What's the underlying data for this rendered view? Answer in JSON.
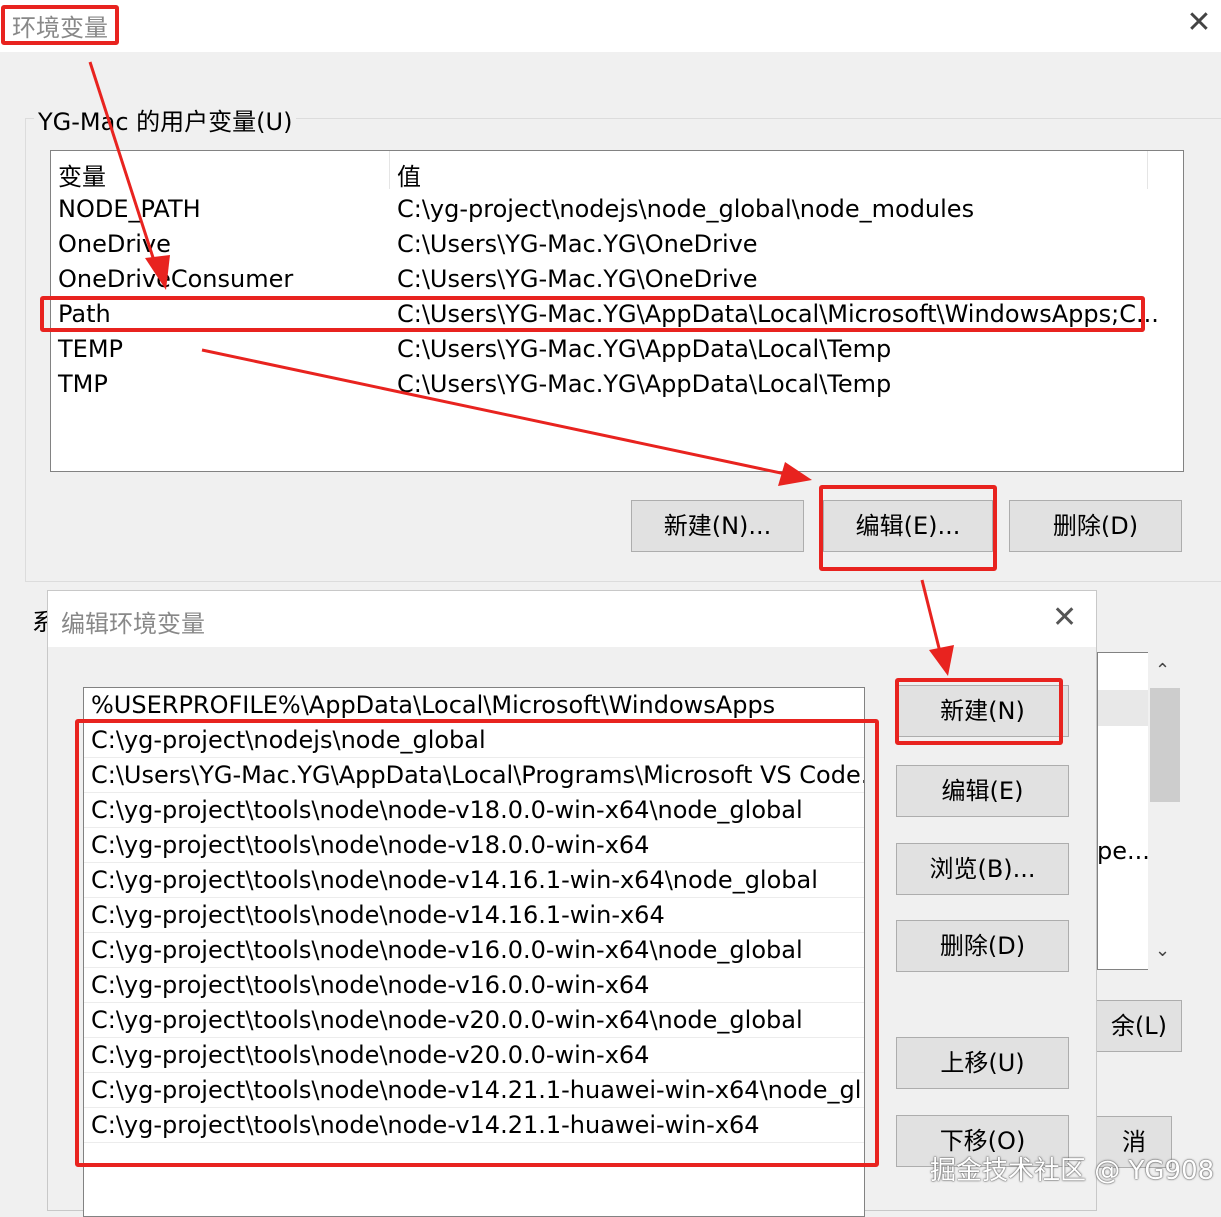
{
  "outer_dialog": {
    "title": "环境变量",
    "user_group_label": "YG-Mac 的用户变量(U)",
    "columns": {
      "name": "变量",
      "value": "值"
    },
    "user_vars": [
      {
        "name": "NODE_PATH",
        "value": "C:\\yg-project\\nodejs\\node_global\\node_modules"
      },
      {
        "name": "OneDrive",
        "value": "C:\\Users\\YG-Mac.YG\\OneDrive"
      },
      {
        "name": "OneDriveConsumer",
        "value": "C:\\Users\\YG-Mac.YG\\OneDrive"
      },
      {
        "name": "Path",
        "value": "C:\\Users\\YG-Mac.YG\\AppData\\Local\\Microsoft\\WindowsApps;C..."
      },
      {
        "name": "TEMP",
        "value": "C:\\Users\\YG-Mac.YG\\AppData\\Local\\Temp"
      },
      {
        "name": "TMP",
        "value": "C:\\Users\\YG-Mac.YG\\AppData\\Local\\Temp"
      }
    ],
    "buttons": {
      "new": "新建(N)...",
      "edit": "编辑(E)...",
      "delete": "删除(D)"
    },
    "sys_group_label_peek": "系",
    "sys_text_peek": "pe...",
    "sys_delete_peek": "余(L)",
    "cancel_peek": "消"
  },
  "inner_dialog": {
    "title": "编辑环境变量",
    "paths": [
      "%USERPROFILE%\\AppData\\Local\\Microsoft\\WindowsApps",
      "C:\\yg-project\\nodejs\\node_global",
      "C:\\Users\\YG-Mac.YG\\AppData\\Local\\Programs\\Microsoft VS Code...",
      "C:\\yg-project\\tools\\node\\node-v18.0.0-win-x64\\node_global",
      "C:\\yg-project\\tools\\node\\node-v18.0.0-win-x64",
      "C:\\yg-project\\tools\\node\\node-v14.16.1-win-x64\\node_global",
      "C:\\yg-project\\tools\\node\\node-v14.16.1-win-x64",
      "C:\\yg-project\\tools\\node\\node-v16.0.0-win-x64\\node_global",
      "C:\\yg-project\\tools\\node\\node-v16.0.0-win-x64",
      "C:\\yg-project\\tools\\node\\node-v20.0.0-win-x64\\node_global",
      "C:\\yg-project\\tools\\node\\node-v20.0.0-win-x64",
      "C:\\yg-project\\tools\\node\\node-v14.21.1-huawei-win-x64\\node_gl...",
      "C:\\yg-project\\tools\\node\\node-v14.21.1-huawei-win-x64"
    ],
    "buttons": {
      "new": "新建(N)",
      "edit": "编辑(E)",
      "browse": "浏览(B)...",
      "delete": "删除(D)",
      "move_up": "上移(U)",
      "move_down": "下移(O)"
    }
  },
  "watermark": "掘金技术社区 @ YG908",
  "annotation_color": "#e8231f"
}
